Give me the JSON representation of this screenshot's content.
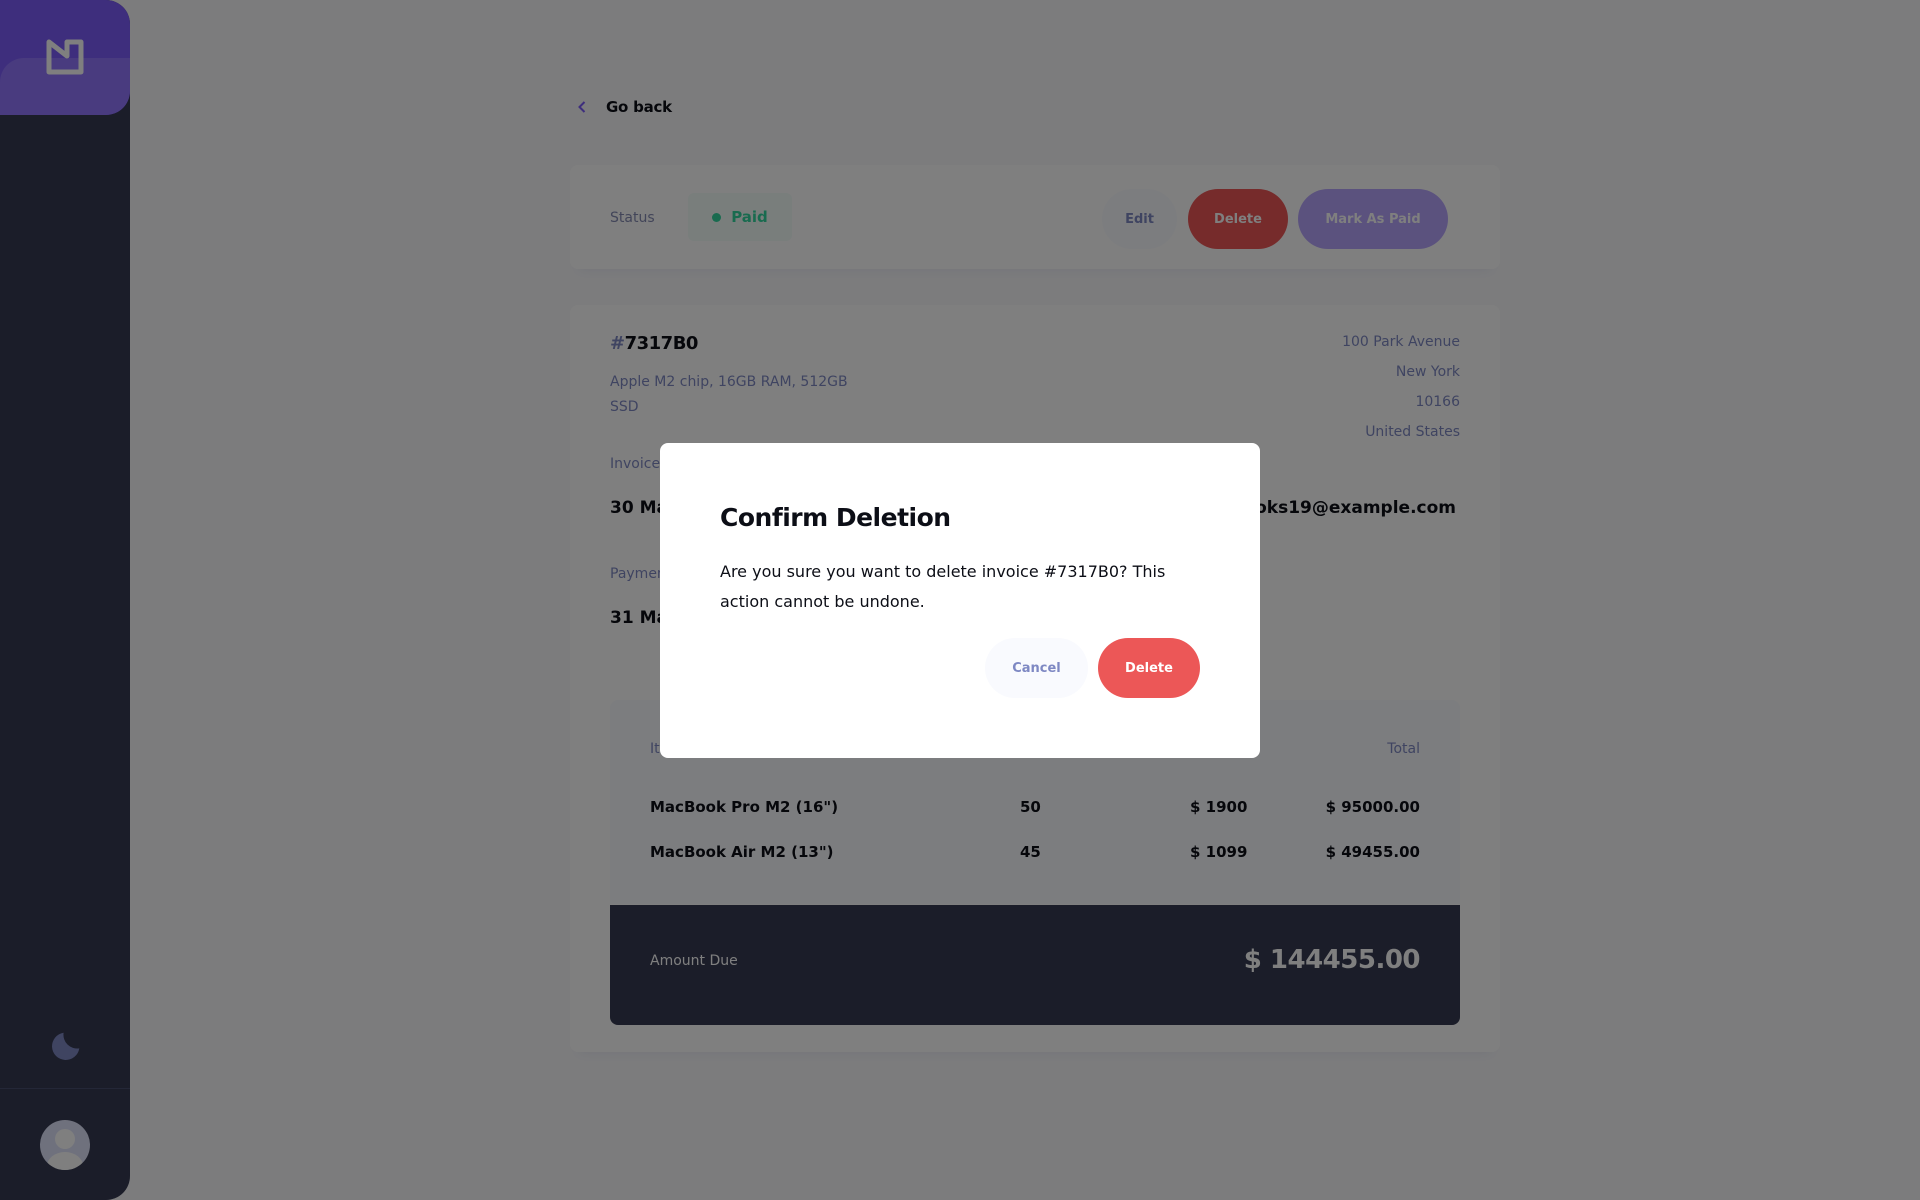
{
  "sidebar": {
    "logo_icon": "logo-icon",
    "theme_toggle_icon": "moon-icon",
    "avatar_icon": "user-avatar"
  },
  "nav": {
    "go_back_label": "Go back",
    "go_back_icon": "chevron-left-icon"
  },
  "status_bar": {
    "status_label": "Status",
    "status_value": "Paid",
    "edit_label": "Edit",
    "delete_label": "Delete",
    "mark_paid_label": "Mark As Paid"
  },
  "invoice": {
    "id_hash": "#",
    "id": "7317B0",
    "description": "Apple M2 chip, 16GB RAM, 512GB SSD",
    "sender_address": [
      "100 Park Avenue",
      "New York",
      "10166",
      "United States"
    ],
    "invoice_date_label": "Invoice",
    "invoice_date_value": "30 Ma",
    "payment_due_label": "Paymen",
    "payment_due_value": "31 Ma",
    "client_email": "ooks19@example.com"
  },
  "items": {
    "header_item": "It",
    "header_total": "Total",
    "rows": [
      {
        "name": "MacBook Pro M2 (16\")",
        "qty": "50",
        "price": "$ 1900",
        "total": "$ 95000.00"
      },
      {
        "name": "MacBook Air M2 (13\")",
        "qty": "45",
        "price": "$ 1099",
        "total": "$ 49455.00"
      }
    ],
    "amount_due_label": "Amount Due",
    "amount_due_value": "$ 144455.00"
  },
  "modal": {
    "title": "Confirm Deletion",
    "message": "Are you sure you want to delete invoice #7317B0? This action cannot be undone.",
    "cancel_label": "Cancel",
    "delete_label": "Delete"
  },
  "colors": {
    "primary": "#7c5dfa",
    "danger": "#ec5757",
    "paid": "#33d69f",
    "sidebar": "#373b53"
  }
}
